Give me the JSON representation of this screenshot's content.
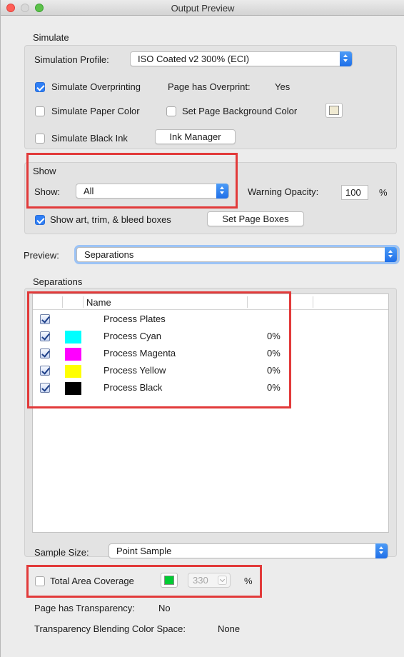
{
  "window": {
    "title": "Output Preview"
  },
  "simulate": {
    "heading": "Simulate",
    "profile_label": "Simulation Profile:",
    "profile_value": "ISO Coated v2 300% (ECI)",
    "overprinting_label": "Simulate Overprinting",
    "overprinting_checked": true,
    "page_overprint_label": "Page has Overprint:",
    "page_overprint_value": "Yes",
    "paper_color_label": "Simulate Paper Color",
    "page_bg_label": "Set Page Background Color",
    "page_bg_color": "#f0ead2",
    "black_ink_label": "Simulate Black Ink",
    "ink_manager_label": "Ink Manager"
  },
  "show": {
    "heading": "Show",
    "show_label": "Show:",
    "show_value": "All",
    "warning_opacity_label": "Warning Opacity:",
    "warning_opacity_value": "100",
    "percent": "%",
    "boxes_label": "Show art, trim, & bleed boxes",
    "boxes_checked": true,
    "set_page_boxes_label": "Set Page Boxes"
  },
  "preview": {
    "label": "Preview:",
    "value": "Separations"
  },
  "separations": {
    "heading": "Separations",
    "column_name": "Name",
    "rows": [
      {
        "name": "Process Plates",
        "color": "",
        "pct": ""
      },
      {
        "name": "Process Cyan",
        "color": "#00ffff",
        "pct": "0%"
      },
      {
        "name": "Process Magenta",
        "color": "#ff00ff",
        "pct": "0%"
      },
      {
        "name": "Process Yellow",
        "color": "#ffff00",
        "pct": "0%"
      },
      {
        "name": "Process Black",
        "color": "#000000",
        "pct": "0%"
      }
    ]
  },
  "sample": {
    "label": "Sample Size:",
    "value": "Point Sample"
  },
  "tac": {
    "label": "Total Area Coverage",
    "color": "#00cc33",
    "value": "330",
    "percent": "%"
  },
  "transparency": {
    "label": "Page has Transparency:",
    "value": "No",
    "blend_label": "Transparency Blending Color Space:",
    "blend_value": "None"
  }
}
